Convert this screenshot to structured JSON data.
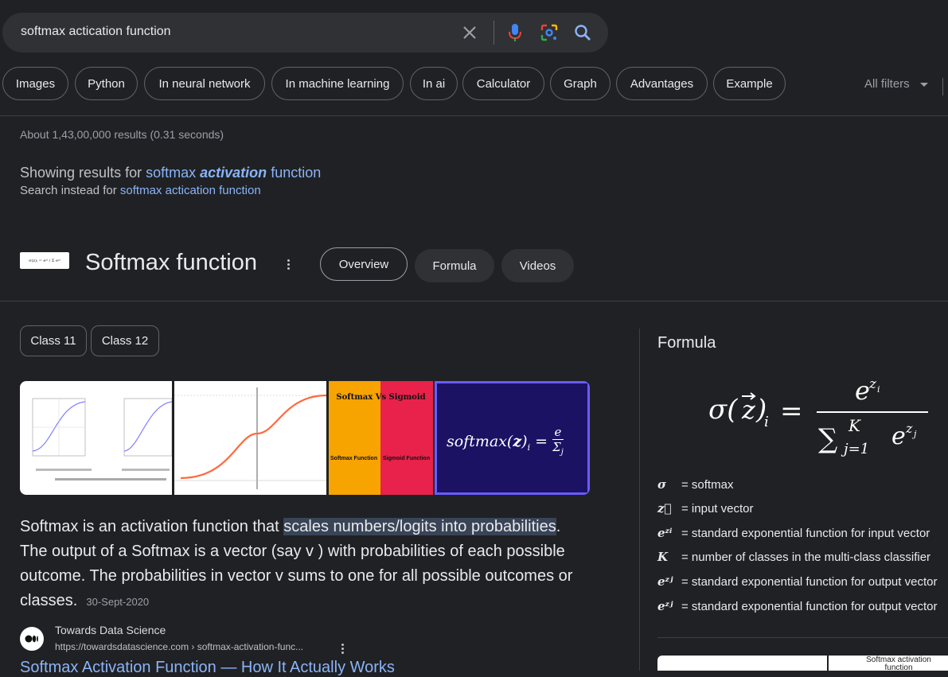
{
  "search": {
    "query": "softmax actication function",
    "icons": [
      "close-icon",
      "microphone-icon",
      "lens-icon",
      "search-icon"
    ]
  },
  "chips": {
    "items": [
      "Images",
      "Python",
      "In neural network",
      "In machine learning",
      "In ai",
      "Calculator",
      "Graph",
      "Advantages",
      "Example"
    ],
    "all_filters": "All filters"
  },
  "results": {
    "stats": "About 1,43,00,000 results (0.31 seconds)",
    "showing_prefix": "Showing results for",
    "corrected_1": "softmax",
    "corrected_2": "activation",
    "corrected_3": "function",
    "instead_prefix": "Search instead for",
    "instead_query": "softmax actication function"
  },
  "knowledge_panel": {
    "title": "Softmax function",
    "tabs": [
      "Overview",
      "Formula",
      "Videos"
    ],
    "class_chips": [
      "Class 11",
      "Class 12"
    ],
    "images": {
      "img3_title": "Softmax Vs Sigmoid",
      "img3_left": "Softmax Function",
      "img3_right": "Sigmoid Function"
    },
    "description": {
      "pre": "Softmax is an activation function that ",
      "highlight": "scales numbers/logits into probabilities",
      "post": ". The output of a Softmax is a vector (say v ) with probabilities of each possible outcome. The probabilities in vector v sums to one for all possible outcomes or classes.",
      "date": "30-Sept-2020"
    },
    "source": {
      "name": "Towards Data Science",
      "url": "https://towardsdatascience.com › softmax-activation-func...",
      "result_title": "Softmax Activation Function — How It Actually Works"
    }
  },
  "formula_panel": {
    "heading": "Formula",
    "legend": [
      {
        "symbol": "σ",
        "text": "= softmax"
      },
      {
        "symbol": "z⃗",
        "text": "= input vector"
      },
      {
        "symbol": "eᶻⁱ",
        "text": "= standard exponential function for input vector"
      },
      {
        "symbol": "K",
        "text": "= number of classes in the multi-class classifier"
      },
      {
        "symbol": "eᶻʲ",
        "text": "= standard exponential function for output vector"
      },
      {
        "symbol": "eᶻʲ",
        "text": "= standard exponential function for output vector"
      }
    ],
    "bottom_image_label": "Softmax activation function"
  }
}
